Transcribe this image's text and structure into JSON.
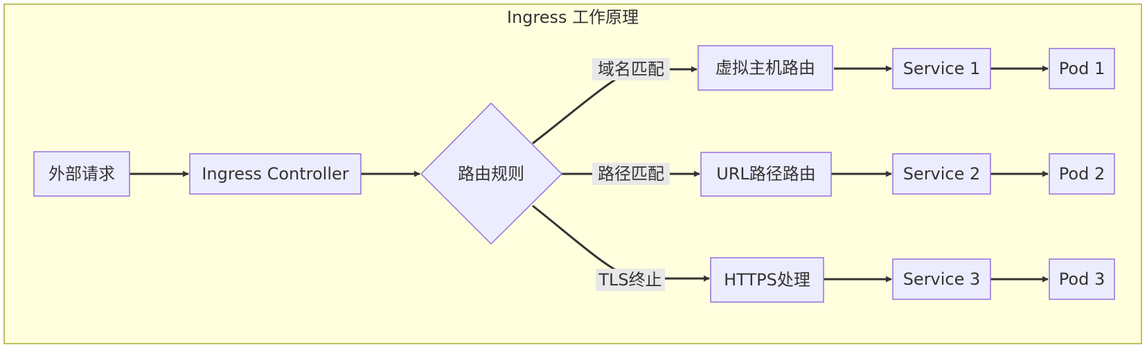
{
  "colors": {
    "cluster_fill": "#ffffde",
    "cluster_stroke": "#aaaa33",
    "node_fill": "#ececff",
    "node_stroke": "#9370db",
    "edge": "#333333",
    "edge_label_bg": "#e8e8e8",
    "text": "#333333"
  },
  "cluster": {
    "title": "Ingress 工作原理"
  },
  "nodes": {
    "client": "外部请求",
    "controller": "Ingress Controller",
    "rules": "路由规则",
    "vhost": "虚拟主机路由",
    "urlpath": "URL路径路由",
    "https": "HTTPS处理",
    "svc1": "Service 1",
    "svc2": "Service 2",
    "svc3": "Service 3",
    "pod1": "Pod 1",
    "pod2": "Pod 2",
    "pod3": "Pod 3"
  },
  "edge_labels": {
    "domain": "域名匹配",
    "path": "路径匹配",
    "tls": "TLS终止"
  }
}
